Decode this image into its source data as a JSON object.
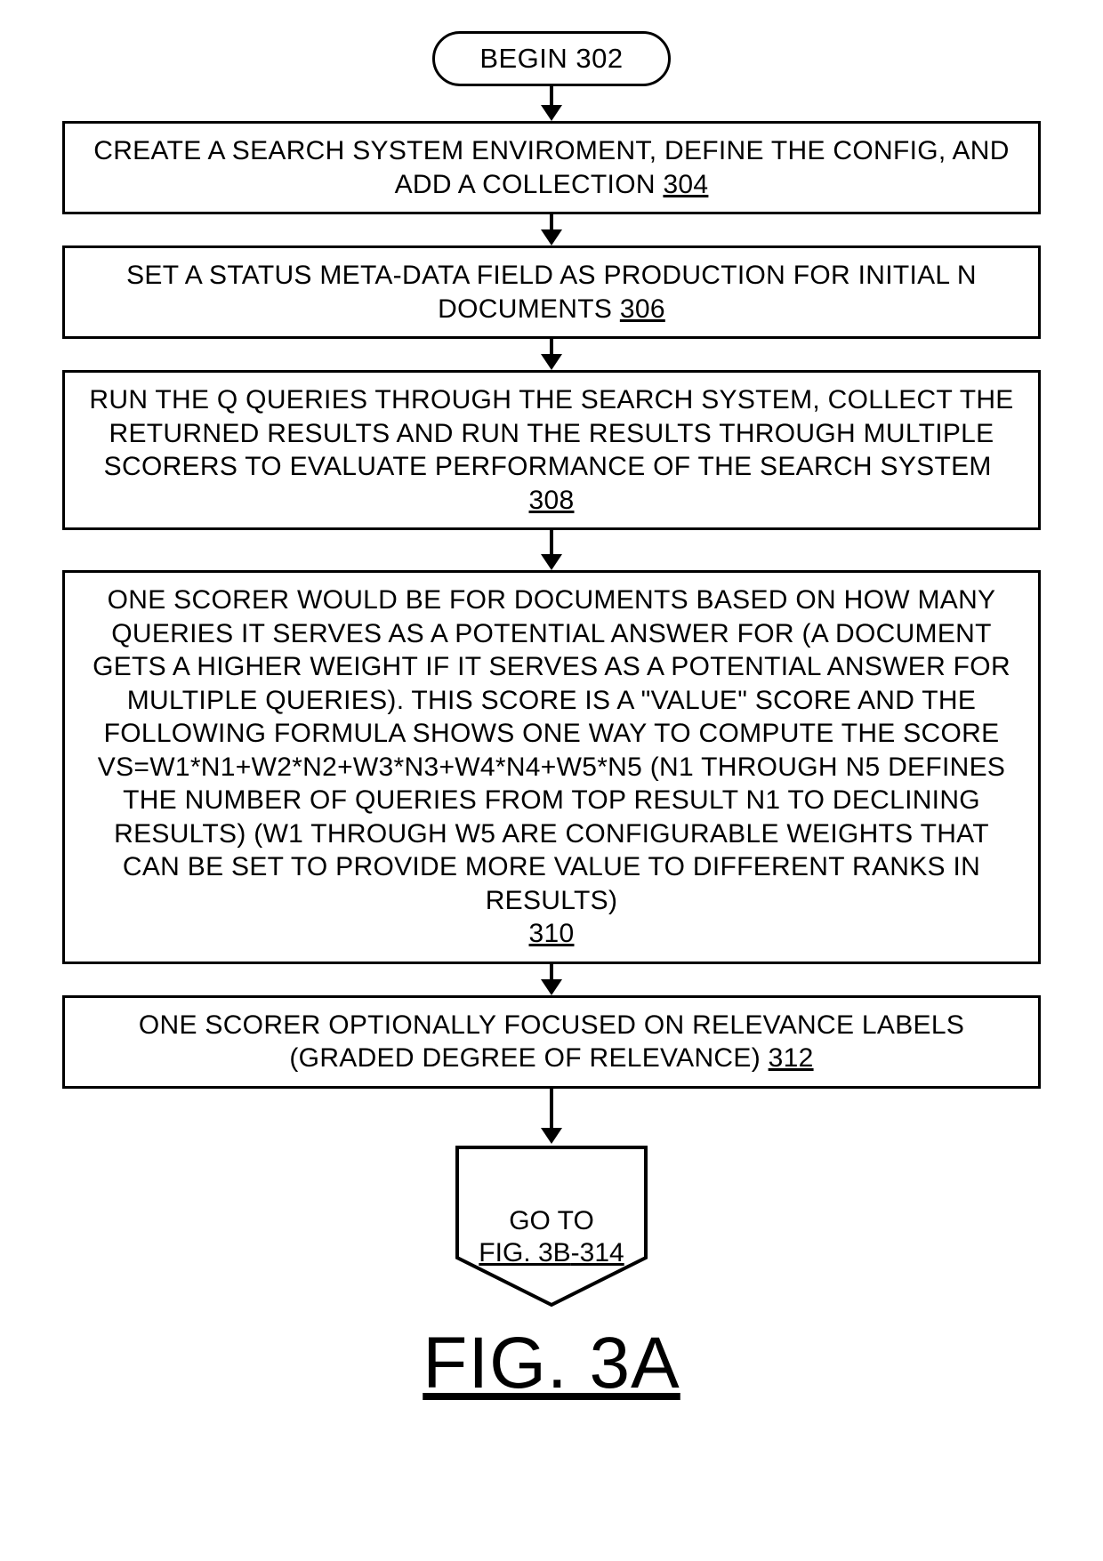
{
  "terminal": {
    "label": "BEGIN",
    "ref": "302"
  },
  "steps": [
    {
      "text": "CREATE A SEARCH SYSTEM ENVIROMENT, DEFINE THE CONFIG, AND ADD A COLLECTION",
      "ref": "304"
    },
    {
      "text": "SET A STATUS META-DATA FIELD AS PRODUCTION FOR INITIAL N DOCUMENTS",
      "ref": "306"
    },
    {
      "text": "RUN THE Q QUERIES THROUGH THE SEARCH SYSTEM, COLLECT THE RETURNED RESULTS AND RUN THE RESULTS THROUGH MULTIPLE SCORERS TO EVALUATE PERFORMANCE OF THE SEARCH SYSTEM",
      "ref": "308"
    },
    {
      "text": "ONE SCORER WOULD BE FOR DOCUMENTS BASED ON HOW MANY QUERIES IT SERVES AS A POTENTIAL ANSWER FOR (A DOCUMENT GETS A HIGHER WEIGHT IF IT SERVES AS A POTENTIAL ANSWER FOR MULTIPLE QUERIES). THIS SCORE IS A \"VALUE\" SCORE AND THE FOLLOWING FORMULA SHOWS ONE WAY TO COMPUTE THE SCORE VS=W1*N1+W2*N2+W3*N3+W4*N4+W5*N5 (N1 THROUGH N5 DEFINES THE NUMBER OF QUERIES FROM TOP RESULT N1 TO DECLINING RESULTS) (W1 THROUGH W5 ARE CONFIGURABLE WEIGHTS THAT CAN BE SET TO PROVIDE MORE VALUE TO DIFFERENT RANKS IN RESULTS)",
      "ref": "310"
    },
    {
      "text": "ONE SCORER OPTIONALLY FOCUSED ON RELEVANCE LABELS (GRADED DEGREE OF RELEVANCE)",
      "ref": "312"
    }
  ],
  "connector": {
    "line1": "GO TO",
    "line2_pre": "FIG. 3B",
    "line2_ref": "-314"
  },
  "figure_label": "FIG. 3A"
}
